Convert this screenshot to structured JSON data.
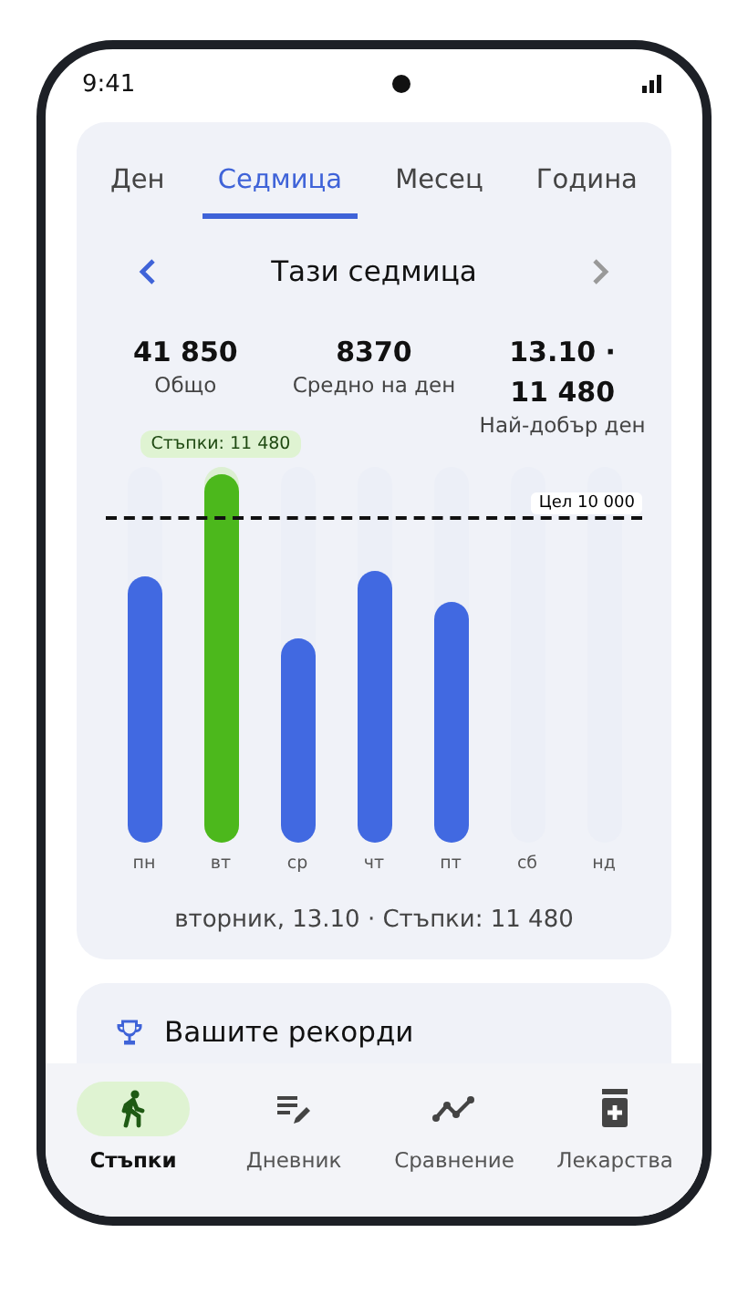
{
  "status_bar": {
    "time": "9:41"
  },
  "tabs": [
    {
      "label": "Ден",
      "selected": false
    },
    {
      "label": "Седмица",
      "selected": true
    },
    {
      "label": "Месец",
      "selected": false
    },
    {
      "label": "Година",
      "selected": false
    }
  ],
  "period": {
    "title": "Тази седмица",
    "prev_disabled": false,
    "next_disabled": true
  },
  "stats": [
    {
      "value": "41 850",
      "label": "Общо"
    },
    {
      "value": "8370",
      "label": "Средно на ден"
    },
    {
      "value": "13.10 · 11 480",
      "label": "Най-добър ден"
    }
  ],
  "goal_label": "Цел 10 000",
  "days": [
    {
      "label": "пн",
      "level": 0.71,
      "selected": false
    },
    {
      "label": "вт",
      "level": 0.98,
      "selected": true,
      "tooltip": "Стъпки: 11 480"
    },
    {
      "label": "ср",
      "level": 0.545,
      "selected": false
    },
    {
      "label": "чт",
      "level": 0.725,
      "selected": false
    },
    {
      "label": "пт",
      "level": 0.64,
      "selected": false
    },
    {
      "label": "сб",
      "selected": false
    },
    {
      "label": "нд",
      "selected": false
    }
  ],
  "caption": "вторник, 13.10 · Стъпки: 11 480",
  "records": {
    "title": "Вашите рекорди"
  },
  "nav": [
    {
      "label": "Стъпки",
      "kind": "steps",
      "selected": true
    },
    {
      "label": "Дневник",
      "kind": "diary",
      "selected": false
    },
    {
      "label": "Сравнение",
      "kind": "compare",
      "selected": false
    },
    {
      "label": "Лекарства",
      "kind": "meds",
      "selected": false
    }
  ]
}
